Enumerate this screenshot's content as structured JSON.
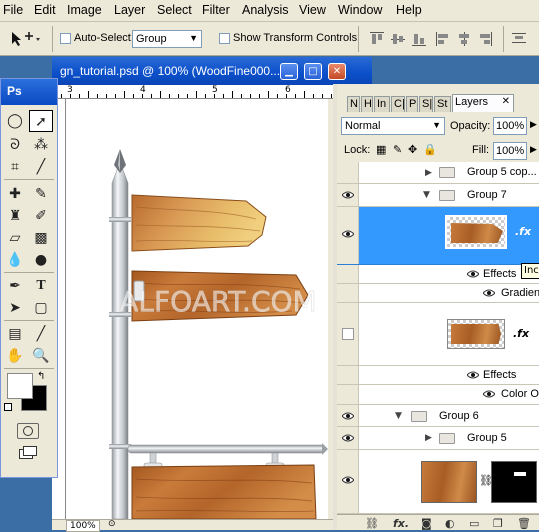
{
  "menu": [
    "File",
    "Edit",
    "Image",
    "Layer",
    "Select",
    "Filter",
    "Analysis",
    "View",
    "Window",
    "Help"
  ],
  "options": {
    "auto_select_label": "Auto-Select:",
    "auto_select_value": "Group",
    "transform_label": "Show Transform Controls"
  },
  "document": {
    "title": "gn_tutorial.psd @ 100% (WoodFine000...",
    "ruler_labels": [
      "3",
      "4",
      "5",
      "6"
    ],
    "zoom": "100%",
    "watermark": "ALFOART.COM"
  },
  "toolbox": {
    "logo": "Ps"
  },
  "layers_panel": {
    "tabs": [
      "N",
      "H",
      "In",
      "C|",
      "P",
      "S|",
      "St",
      "Layers"
    ],
    "blend_mode": "Normal",
    "opacity_label": "Opacity:",
    "opacity_value": "100%",
    "lock_label": "Lock:",
    "fill_label": "Fill:",
    "fill_value": "100%",
    "rows": {
      "group5copy": "Group 5 cop...",
      "group7": "Group 7",
      "effects1": "Effects",
      "gradient": "Gradien...",
      "effects2": "Effects",
      "coloroverlay": "Color O...",
      "group6": "Group 6",
      "group5": "Group 5"
    },
    "tooltip": "Inc",
    "fx": ".fx"
  },
  "colors": {
    "title_blue": "#0b4fc9",
    "selected_layer": "#3399ff",
    "wood": "#c47a3c"
  }
}
